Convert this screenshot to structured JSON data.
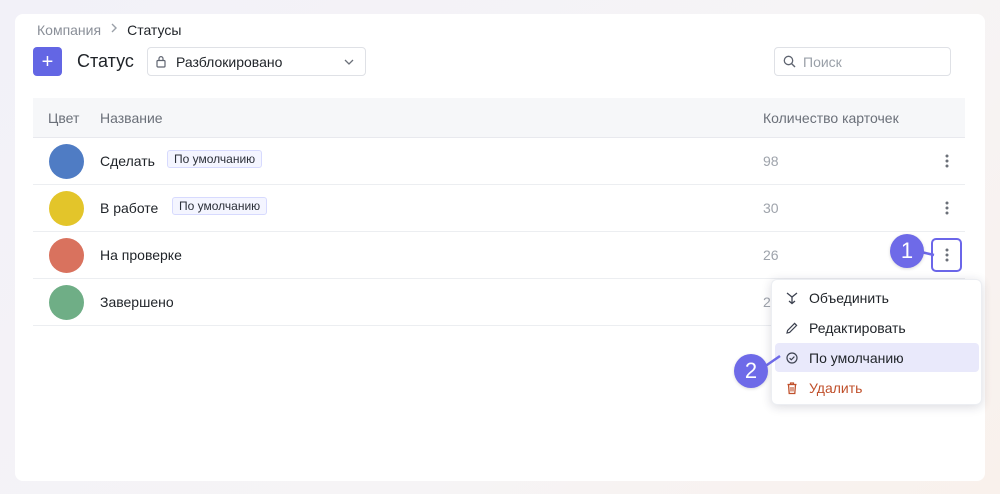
{
  "breadcrumb": {
    "parent": "Компания",
    "separator": ">",
    "current": "Статусы"
  },
  "header": {
    "add_label": "+",
    "title": "Статус",
    "filter_value": "Разблокировано",
    "search_placeholder": "Поиск"
  },
  "table": {
    "columns": {
      "color": "Цвет",
      "name": "Название",
      "count": "Количество карточек"
    },
    "rows": [
      {
        "name": "Сделать",
        "badge": "По умолчанию",
        "count": "98",
        "color": "#4f7cc4"
      },
      {
        "name": "В работе",
        "badge": "По умолчанию",
        "count": "30",
        "color": "#e3c52a"
      },
      {
        "name": "На проверке",
        "badge": "",
        "count": "26",
        "color": "#d9725e"
      },
      {
        "name": "Завершено",
        "badge": "",
        "count": "2",
        "color": "#6fae86"
      }
    ]
  },
  "menu": {
    "items": [
      {
        "label": "Объединить",
        "icon": "merge-icon"
      },
      {
        "label": "Редактировать",
        "icon": "pencil-icon"
      },
      {
        "label": "По умолчанию",
        "icon": "check-circle-icon"
      },
      {
        "label": "Удалить",
        "icon": "trash-icon"
      }
    ]
  },
  "callouts": {
    "first": "1",
    "second": "2"
  },
  "colors": {
    "accent": "#6366e4",
    "danger": "#c0502b",
    "highlight": "#e9e9fb"
  }
}
